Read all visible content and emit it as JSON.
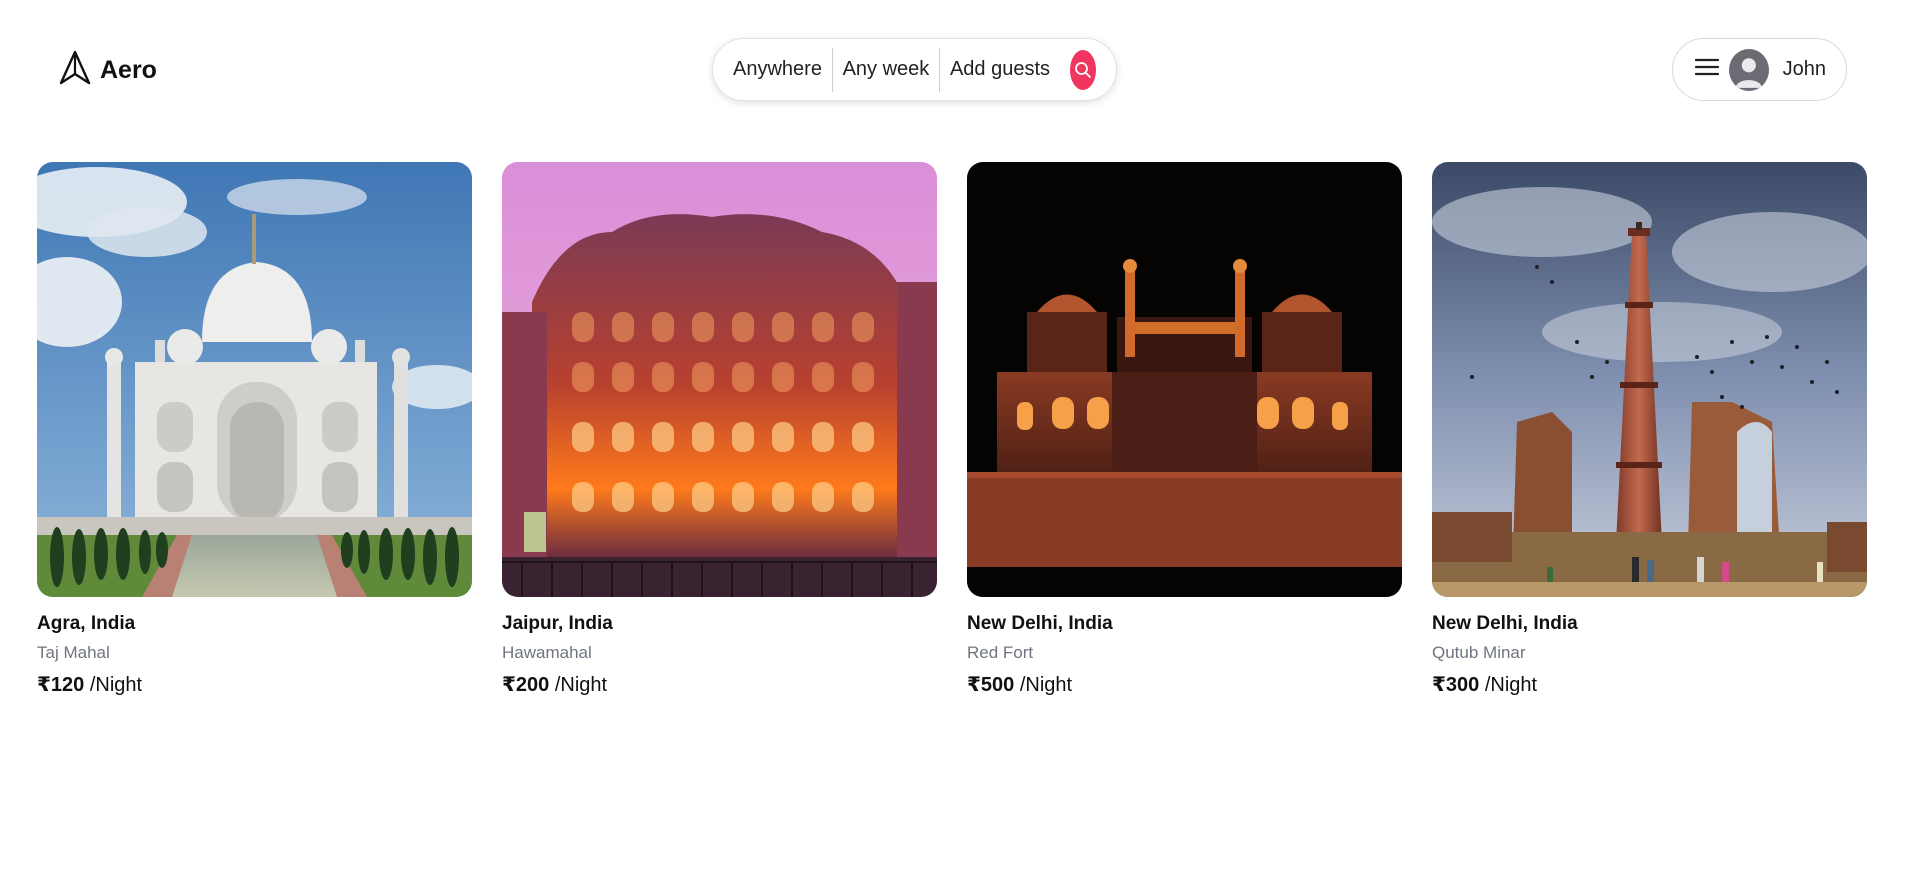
{
  "brand": {
    "name": "Aero",
    "icon": "paper-plane-icon"
  },
  "search": {
    "where": "Anywhere",
    "when": "Any week",
    "guests": "Add guests",
    "icon": "search-icon",
    "accent": "#f0365f"
  },
  "user": {
    "name": "John",
    "menu_icon": "hamburger-menu-icon",
    "avatar_icon": "user-avatar-icon"
  },
  "listings": [
    {
      "city": "Agra, India",
      "place": "Taj Mahal",
      "price": "₹120",
      "unit": "/Night"
    },
    {
      "city": "Jaipur, India",
      "place": "Hawamahal",
      "price": "₹200",
      "unit": "/Night"
    },
    {
      "city": "New Delhi, India",
      "place": "Red Fort",
      "price": "₹500",
      "unit": "/Night"
    },
    {
      "city": "New Delhi, India",
      "place": "Qutub Minar",
      "price": "₹300",
      "unit": "/Night"
    }
  ]
}
